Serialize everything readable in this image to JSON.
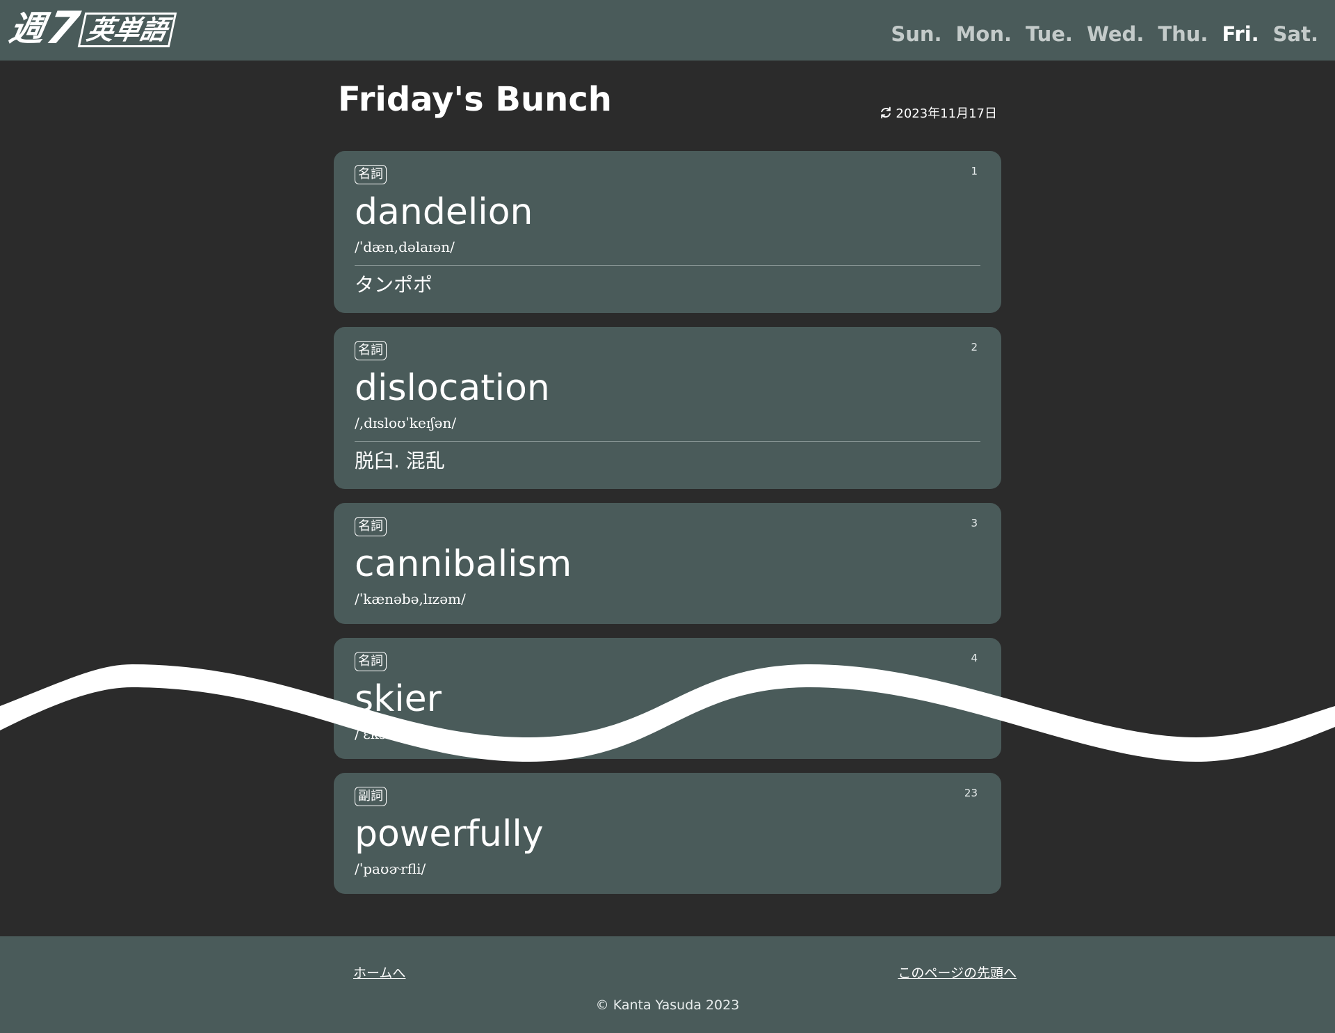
{
  "header": {
    "logo": {
      "kanji": "週",
      "number": "7",
      "word": "英単語"
    },
    "nav": [
      {
        "label": "Sun.",
        "active": false
      },
      {
        "label": "Mon.",
        "active": false
      },
      {
        "label": "Tue.",
        "active": false
      },
      {
        "label": "Wed.",
        "active": false
      },
      {
        "label": "Thu.",
        "active": false
      },
      {
        "label": "Fri.",
        "active": true
      },
      {
        "label": "Sat.",
        "active": false
      }
    ]
  },
  "main": {
    "title": "Friday's Bunch",
    "updated_date": "2023年11月17日",
    "cards": [
      {
        "number": "1",
        "pos": "名詞",
        "word": "dandelion",
        "pronunciation": "/ˈdæn,dəlaɪən/",
        "meaning": "タンポポ"
      },
      {
        "number": "2",
        "pos": "名詞",
        "word": "dislocation",
        "pronunciation": "/,dɪsloʊˈkeɪʃən/",
        "meaning": "脱臼. 混乱"
      },
      {
        "number": "3",
        "pos": "名詞",
        "word": "cannibalism",
        "pronunciation": "/ˈkænəbə,lɪzəm/",
        "meaning": ""
      },
      {
        "number": "4",
        "pos": "名詞",
        "word": "skier",
        "pronunciation": "/ˈɛkskwɪzɪt/",
        "meaning": ""
      },
      {
        "number": "23",
        "pos": "副詞",
        "word": "powerfully",
        "pronunciation": "/ˈpaʊɚrfli/",
        "meaning": ""
      }
    ]
  },
  "footer": {
    "home_link": "ホームへ",
    "top_link": "このページの先頭へ",
    "copyright": "© Kanta Yasuda 2023"
  },
  "colors": {
    "background": "#2b2b2b",
    "panel": "#4a5b5a",
    "text": "#ffffff",
    "nav_inactive": "#c4cbca"
  }
}
